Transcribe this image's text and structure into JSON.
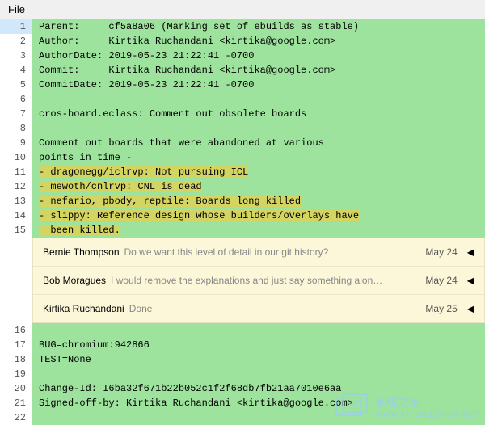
{
  "topbar": {
    "file_label": "File"
  },
  "lines": [
    {
      "n": 1,
      "text": "Parent:     cf5a8a06 (Marking set of ebuilds as stable)"
    },
    {
      "n": 2,
      "text": "Author:     Kirtika Ruchandani <kirtika@google.com>"
    },
    {
      "n": 3,
      "text": "AuthorDate: 2019-05-23 21:22:41 -0700"
    },
    {
      "n": 4,
      "text": "Commit:     Kirtika Ruchandani <kirtika@google.com>"
    },
    {
      "n": 5,
      "text": "CommitDate: 2019-05-23 21:22:41 -0700"
    },
    {
      "n": 6,
      "text": ""
    },
    {
      "n": 7,
      "text": "cros-board.eclass: Comment out obsolete boards"
    },
    {
      "n": 8,
      "text": ""
    },
    {
      "n": 9,
      "text": "Comment out boards that were abandoned at various"
    },
    {
      "n": 10,
      "text": "points in time -"
    },
    {
      "n": 11,
      "text": "- dragonegg/iclrvp: Not pursuing ICL",
      "hl": true
    },
    {
      "n": 12,
      "text": "- mewoth/cnlrvp: CNL is dead",
      "hl": true
    },
    {
      "n": 13,
      "text": "- nefario, pbody, reptile: Boards long killed",
      "hl": true
    },
    {
      "n": 14,
      "text": "- slippy: Reference design whose builders/overlays have",
      "hl": true
    },
    {
      "n": 15,
      "text": "  been killed.",
      "hl": true
    }
  ],
  "comments": [
    {
      "author": "Bernie Thompson",
      "text": "Do we want this level of detail in our git history?",
      "date": "May 24"
    },
    {
      "author": "Bob Moragues",
      "text": "I would remove the explanations and just say something alon…",
      "date": "May 24"
    },
    {
      "author": "Kirtika Ruchandani",
      "text": "Done",
      "date": "May 25"
    }
  ],
  "lines_after": [
    {
      "n": 16,
      "text": ""
    },
    {
      "n": 17,
      "text": "BUG=chromium:942866"
    },
    {
      "n": 18,
      "text": "TEST=None"
    },
    {
      "n": 19,
      "text": ""
    },
    {
      "n": 20,
      "text": "Change-Id: I6ba32f671b22b052c1f2f68db7fb21aa7010e6aa"
    },
    {
      "n": 21,
      "text": "Signed-off-by: Kirtika Ruchandani <kirtika@google.com>"
    },
    {
      "n": 22,
      "text": ""
    }
  ],
  "watermark": {
    "brand": "系统之家",
    "url": "WWW.XITONGZHIJIA.NET"
  }
}
